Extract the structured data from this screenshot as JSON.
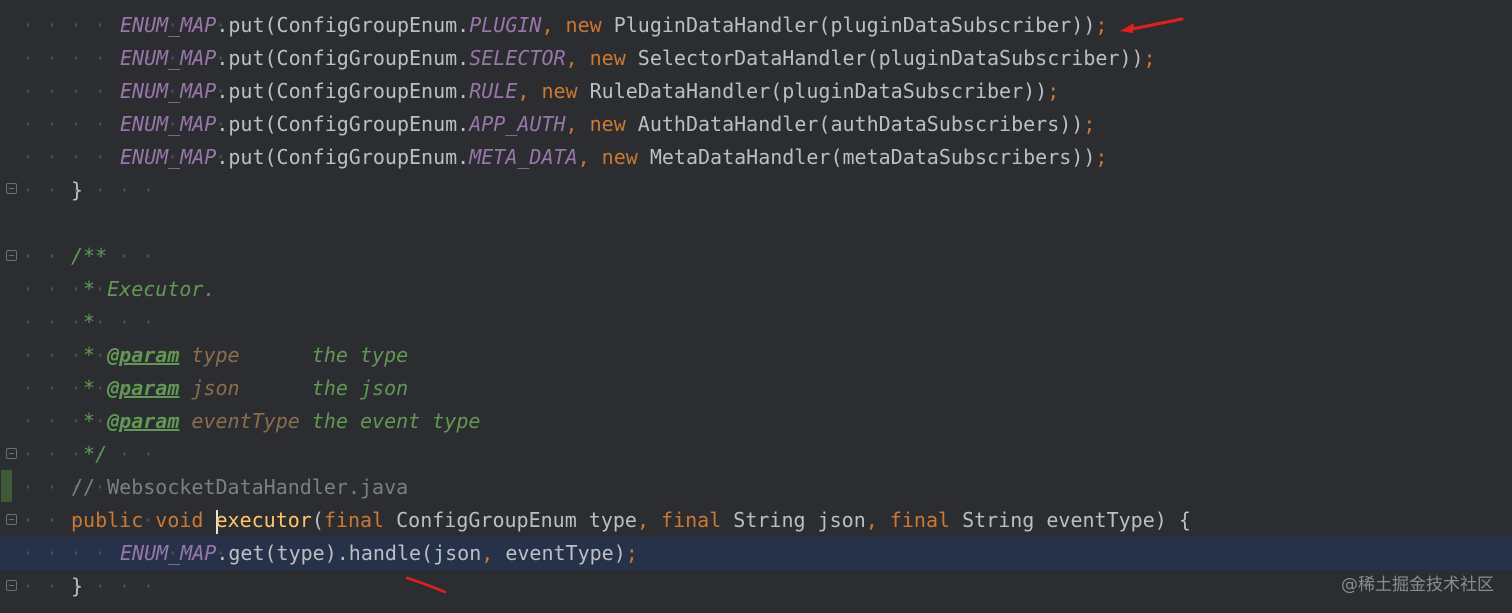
{
  "editor": {
    "lines": [
      {
        "parts": [
          {
            "t": "ENUM_MAP",
            "c": "const"
          },
          {
            "t": ".put(ConfigGroupEnum.",
            "c": "plain"
          },
          {
            "t": "PLUGIN",
            "c": "field"
          },
          {
            "t": ", ",
            "c": "punc"
          },
          {
            "t": "new ",
            "c": "kw"
          },
          {
            "t": "PluginDataHandler(pluginDataSubscriber))",
            "c": "plain"
          },
          {
            "t": ";",
            "c": "punc"
          }
        ]
      },
      {
        "parts": [
          {
            "t": "ENUM_MAP",
            "c": "const"
          },
          {
            "t": ".put(ConfigGroupEnum.",
            "c": "plain"
          },
          {
            "t": "SELECTOR",
            "c": "field"
          },
          {
            "t": ", ",
            "c": "punc"
          },
          {
            "t": "new ",
            "c": "kw"
          },
          {
            "t": "SelectorDataHandler(pluginDataSubscriber))",
            "c": "plain"
          },
          {
            "t": ";",
            "c": "punc"
          }
        ]
      },
      {
        "parts": [
          {
            "t": "ENUM_MAP",
            "c": "const"
          },
          {
            "t": ".put(ConfigGroupEnum.",
            "c": "plain"
          },
          {
            "t": "RULE",
            "c": "field"
          },
          {
            "t": ", ",
            "c": "punc"
          },
          {
            "t": "new ",
            "c": "kw"
          },
          {
            "t": "RuleDataHandler(pluginDataSubscriber))",
            "c": "plain"
          },
          {
            "t": ";",
            "c": "punc"
          }
        ]
      },
      {
        "parts": [
          {
            "t": "ENUM_MAP",
            "c": "const"
          },
          {
            "t": ".put(ConfigGroupEnum.",
            "c": "plain"
          },
          {
            "t": "APP_AUTH",
            "c": "field"
          },
          {
            "t": ", ",
            "c": "punc"
          },
          {
            "t": "new ",
            "c": "kw"
          },
          {
            "t": "AuthDataHandler(authDataSubscribers))",
            "c": "plain"
          },
          {
            "t": ";",
            "c": "punc"
          }
        ]
      },
      {
        "parts": [
          {
            "t": "ENUM_MAP",
            "c": "const"
          },
          {
            "t": ".put(ConfigGroupEnum.",
            "c": "plain"
          },
          {
            "t": "META_DATA",
            "c": "field"
          },
          {
            "t": ", ",
            "c": "punc"
          },
          {
            "t": "new ",
            "c": "kw"
          },
          {
            "t": "MetaDataHandler(metaDataSubscribers))",
            "c": "plain"
          },
          {
            "t": ";",
            "c": "punc"
          }
        ]
      },
      {
        "parts": [
          {
            "t": "}",
            "c": "plain"
          }
        ]
      },
      {
        "parts": []
      },
      {
        "parts": [
          {
            "t": "/**",
            "c": "doc"
          }
        ]
      },
      {
        "parts": [
          {
            "t": " * Executor.",
            "c": "doc"
          }
        ]
      },
      {
        "parts": [
          {
            "t": " *",
            "c": "doc"
          }
        ]
      },
      {
        "parts": [
          {
            "t": " * ",
            "c": "doc"
          },
          {
            "t": "@param",
            "c": "doctag"
          },
          {
            "t": " type",
            "c": "docparam"
          },
          {
            "t": "      the type",
            "c": "doc"
          }
        ]
      },
      {
        "parts": [
          {
            "t": " * ",
            "c": "doc"
          },
          {
            "t": "@param",
            "c": "doctag"
          },
          {
            "t": " json",
            "c": "docparam"
          },
          {
            "t": "      the json",
            "c": "doc"
          }
        ]
      },
      {
        "parts": [
          {
            "t": " * ",
            "c": "doc"
          },
          {
            "t": "@param",
            "c": "doctag"
          },
          {
            "t": " eventType",
            "c": "docparam"
          },
          {
            "t": " the event type",
            "c": "doc"
          }
        ]
      },
      {
        "parts": [
          {
            "t": " */",
            "c": "doc"
          }
        ]
      },
      {
        "parts": [
          {
            "t": "// WebsocketDataHandler.java",
            "c": "linecomment"
          }
        ]
      },
      {
        "parts": [
          {
            "t": "public void ",
            "c": "kw"
          },
          {
            "t": "|",
            "c": "caret"
          },
          {
            "t": "executor",
            "c": "method"
          },
          {
            "t": "(",
            "c": "plain"
          },
          {
            "t": "final ",
            "c": "kw"
          },
          {
            "t": "ConfigGroupEnum type",
            "c": "plain"
          },
          {
            "t": ", ",
            "c": "punc"
          },
          {
            "t": "final ",
            "c": "kw"
          },
          {
            "t": "String json",
            "c": "plain"
          },
          {
            "t": ", ",
            "c": "punc"
          },
          {
            "t": "final ",
            "c": "kw"
          },
          {
            "t": "String eventType) {",
            "c": "plain"
          }
        ]
      },
      {
        "parts": [
          {
            "t": "ENUM_MAP",
            "c": "const"
          },
          {
            "t": ".get(type).handle(json",
            "c": "plain"
          },
          {
            "t": ", ",
            "c": "punc"
          },
          {
            "t": "eventType)",
            "c": "plain"
          },
          {
            "t": ";",
            "c": "punc"
          }
        ]
      },
      {
        "parts": [
          {
            "t": "}",
            "c": "plain"
          }
        ]
      }
    ]
  },
  "watermark": "@稀土掘金技术社区",
  "colors": {
    "background": "#2b2d30",
    "current_line": "#26324a",
    "keyword": "#cc7832",
    "constant": "#9876aa",
    "doc_comment": "#629755",
    "line_comment": "#7a7e85",
    "method": "#ffc66d",
    "annotation_arrow": "#e0201c"
  }
}
